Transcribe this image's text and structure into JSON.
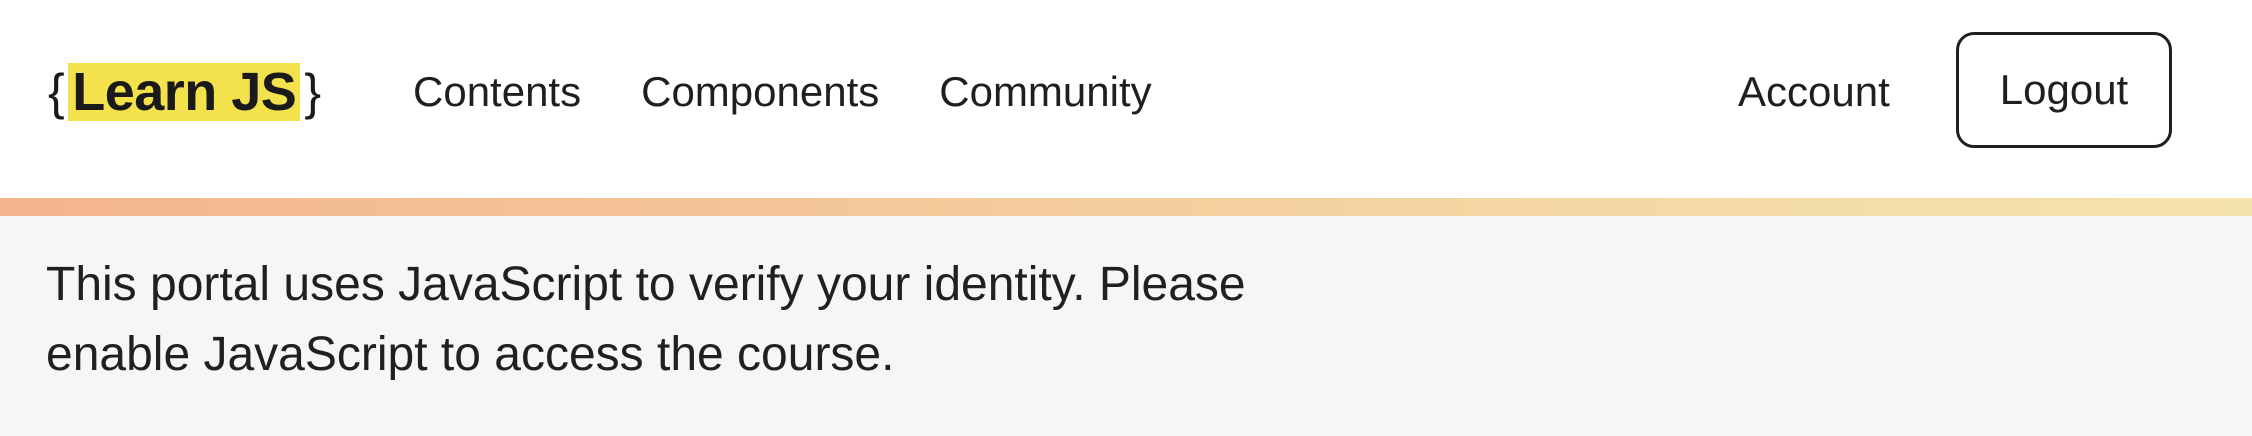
{
  "header": {
    "logo": {
      "brace_open": "{",
      "text": "Learn JS",
      "brace_close": "}",
      "highlight_color": "#f3e24b"
    },
    "nav": [
      {
        "label": "Contents"
      },
      {
        "label": "Components"
      },
      {
        "label": "Community"
      }
    ],
    "account_label": "Account",
    "logout_label": "Logout"
  },
  "notice": {
    "text": "This portal uses JavaScript to verify your identity. Please enable JavaScript to access the course."
  },
  "colors": {
    "gradient_start": "#f3b48e",
    "gradient_end": "#f5e3ae",
    "page_background": "#f6f6f6"
  }
}
